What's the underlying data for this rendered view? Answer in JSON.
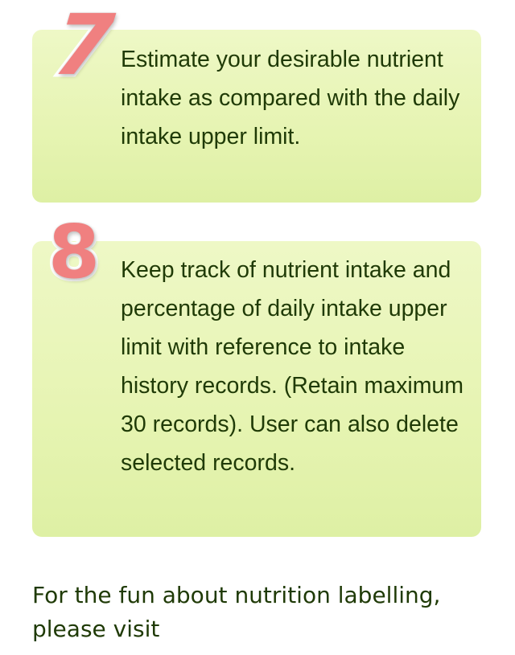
{
  "steps": [
    {
      "number": "7",
      "text": "Estimate your desirable nutrient intake as compared with the daily intake upper limit."
    },
    {
      "number": "8",
      "text": "Keep track of nutrient intake and percentage of daily intake upper limit with reference to intake history records. (Retain maximum 30 records). User can also delete selected records."
    }
  ],
  "footer": {
    "text": "For the fun about nutrition labelling, please visit"
  },
  "colors": {
    "card_background": "#e6f4b2",
    "text": "#1f3a06",
    "number_fill": "#f08080",
    "number_outline": "#ffffff"
  }
}
